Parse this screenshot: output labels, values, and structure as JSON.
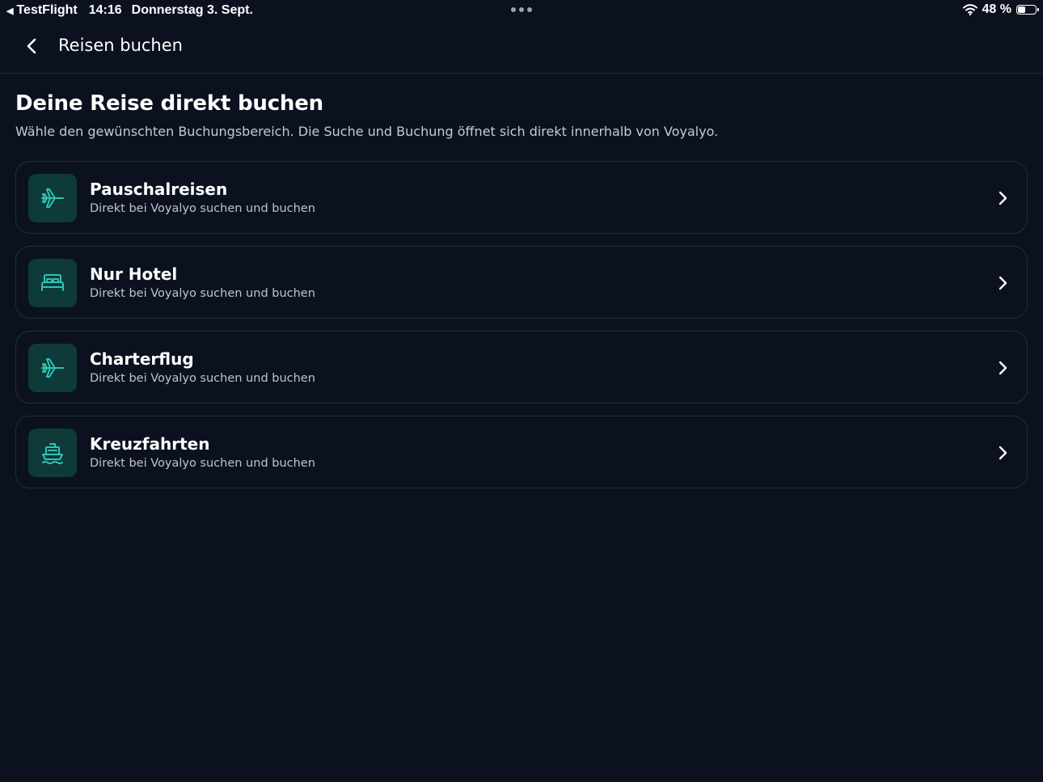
{
  "status_bar": {
    "back_app": "TestFlight",
    "time": "14:16",
    "date": "Donnerstag 3. Sept.",
    "battery_percent": "48 %",
    "battery_level": 0.48,
    "icons": [
      "back-triangle-icon",
      "more-dots-icon",
      "wifi-icon",
      "battery-icon"
    ]
  },
  "nav": {
    "title": "Reisen buchen",
    "back_icon": "chevron-left-icon"
  },
  "main": {
    "title": "Deine Reise direkt buchen",
    "subtitle": "Wähle den gewünschten Buchungsbereich. Die Suche und Buchung öffnet sich direkt innerhalb von Voyalyo."
  },
  "options": [
    {
      "title": "Pauschalreisen",
      "subtitle": "Direkt bei Voyalyo suchen und buchen",
      "icon": "airplane-icon"
    },
    {
      "title": "Nur Hotel",
      "subtitle": "Direkt bei Voyalyo suchen und buchen",
      "icon": "bed-icon"
    },
    {
      "title": "Charterflug",
      "subtitle": "Direkt bei Voyalyo suchen und buchen",
      "icon": "airplane-icon"
    },
    {
      "title": "Kreuzfahrten",
      "subtitle": "Direkt bei Voyalyo suchen und buchen",
      "icon": "ship-icon"
    }
  ],
  "colors": {
    "background": "#0b111f",
    "icon_tile": "#0f3a3a",
    "icon_accent": "#2ec4b6",
    "card_border": "#242c3b"
  }
}
